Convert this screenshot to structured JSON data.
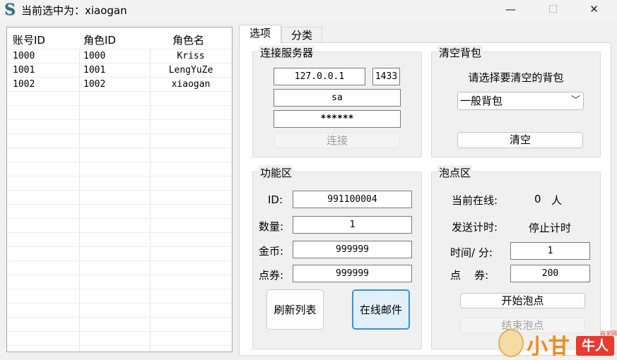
{
  "window": {
    "title": "当前选中为：xiaogan",
    "min_glyph": "—",
    "max_glyph": "☐",
    "close_glyph": "✕",
    "icon": "stylized-s-app-icon"
  },
  "list": {
    "columns": [
      "账号ID",
      "角色ID",
      "角色名"
    ],
    "rows": [
      [
        "1000",
        "1000",
        "Kriss"
      ],
      [
        "1001",
        "1001",
        "LengYuZe"
      ],
      [
        "1002",
        "1002",
        "xiaogan"
      ]
    ]
  },
  "tabs": [
    "选项",
    "分类"
  ],
  "connect": {
    "title": "连接服务器",
    "host": "127.0.0.1",
    "port": "1433",
    "user": "sa",
    "password": "******",
    "button": "连接"
  },
  "clear_bag": {
    "title": "清空背包",
    "prompt": "请选择要清空的背包",
    "selected": "一般背包",
    "button": "清空"
  },
  "functions": {
    "title": "功能区",
    "id_label": "ID:",
    "id_value": "991100004",
    "qty_label": "数量:",
    "qty_value": "1",
    "gold_label": "金币:",
    "gold_value": "999999",
    "coupon_label": "点券:",
    "coupon_value": "999999",
    "refresh_button": "刷新列表",
    "mail_button": "在线邮件"
  },
  "afk": {
    "title": "泡点区",
    "online_label": "当前在线:",
    "online_count": "0",
    "online_unit": "人",
    "timer_label": "发送计时:",
    "timer_value": "停止计时",
    "interval_label": "时间/ 分:",
    "interval_value": "1",
    "points_label": "点    券:",
    "points_value": "200",
    "start_button": "开始泡点",
    "stop_button": "结束泡点"
  },
  "watermark": {
    "text": "小甘",
    "badge": "牛人",
    "small": "商家网"
  }
}
